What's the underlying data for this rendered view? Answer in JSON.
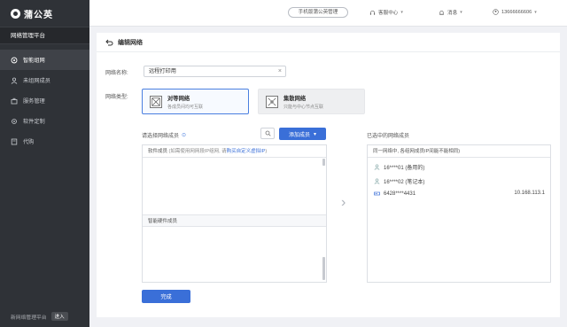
{
  "app": {
    "name": "蒲公英",
    "platform_title": "网络管理平台"
  },
  "sidebar": {
    "items": [
      {
        "label": "智能组网",
        "icon": "network-icon",
        "active": true
      },
      {
        "label": "未组网成员",
        "icon": "user-icon",
        "active": false
      },
      {
        "label": "服务管理",
        "icon": "briefcase-icon",
        "active": false
      },
      {
        "label": "软件定制",
        "icon": "settings-icon",
        "active": false
      },
      {
        "label": "代购",
        "icon": "cart-icon",
        "active": false
      }
    ],
    "footer_text": "新网络管理平台",
    "footer_button": "进入"
  },
  "topbar": {
    "pill": "手机版蒲公英管理",
    "service": "客服中心",
    "messages": "消息",
    "user": "13666666606"
  },
  "page": {
    "title": "编辑网络",
    "name_label": "网络名称:",
    "name_value": "远程打印用",
    "type_label": "网络类型:",
    "types": [
      {
        "title": "对等网络",
        "desc": "各成员间均可互联",
        "selected": true
      },
      {
        "title": "集散网络",
        "desc": "只能与中心节点互联",
        "selected": false
      }
    ],
    "left_section_title": "请选择网络成员",
    "add_button": "添加成员",
    "software_header": "软件成员",
    "software_note": "(如需使用网网段IP组网, 请",
    "software_link": "购买自定义虚拟IP",
    "software_note_end": ")",
    "hardware_header": "智能硬件成员",
    "right_section_title": "已选中的网络成员",
    "right_header": "同一网络中, 各组网成员IP间能不能相同)",
    "members": [
      {
        "name": "16****01 (备用的)",
        "icon": "user-icon",
        "ip": ""
      },
      {
        "name": "16****02 (笔记本)",
        "icon": "user-icon",
        "ip": ""
      },
      {
        "name": "6428****4431",
        "icon": "router-icon",
        "ip": "10.168.113.1"
      }
    ],
    "done_button": "完成"
  },
  "colors": {
    "primary": "#3a6fd8",
    "sidebar": "#2f3237"
  }
}
